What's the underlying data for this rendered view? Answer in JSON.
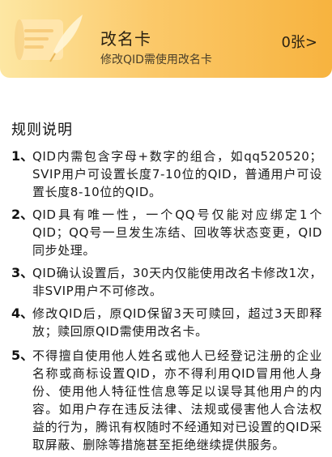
{
  "card": {
    "title": "改名卡",
    "subtitle": "修改QID需使用改名卡",
    "count": "0张>",
    "icon": "scroll-quill-icon",
    "colors": {
      "gradient_start": "#fde7a3",
      "gradient_end": "#f7b33f"
    }
  },
  "rules": {
    "title": "规则说明",
    "items": [
      {
        "num": "1、",
        "text": "QID内需包含字母+数字的组合，如qq520520；SVIP用户可设置长度7-10位的QID，普通用户可设置长度8-10位的QID。"
      },
      {
        "num": "2、",
        "text": "QID具有唯一性，一个QQ号仅能对应绑定1个QID；QQ号一旦发生冻结、回收等状态变更，QID同步处理。"
      },
      {
        "num": "3、",
        "text": "QID确认设置后，30天内仅能使用改名卡修改1次，非SVIP用户不可修改。"
      },
      {
        "num": "4、",
        "text": "修改QID后，原QID保留3天可赎回，超过3天即释放；赎回原QID需使用改名卡。"
      },
      {
        "num": "5、",
        "text": "不得擅自使用他人姓名或他人已经登记注册的企业名称或商标设置QID，亦不得利用QID冒用他人身份、使用他人特征性信息等足以误导其他用户的内容。如用户存在违反法律、法规或侵害他人合法权益的行为，腾讯有权随时不经通知对已设置的QID采取屏蔽、删除等措施甚至拒绝继续提供服务。"
      }
    ]
  }
}
